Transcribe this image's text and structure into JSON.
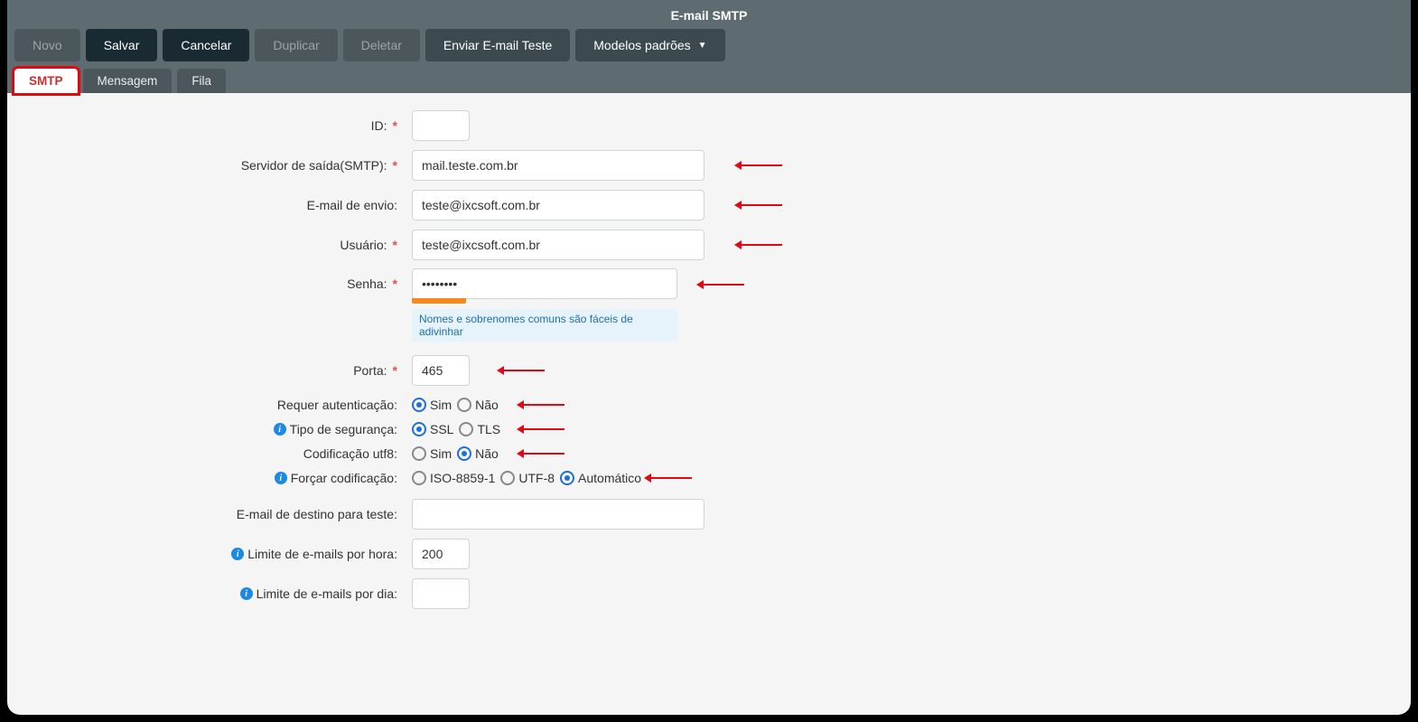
{
  "title": "E-mail SMTP",
  "toolbar": {
    "novo": "Novo",
    "salvar": "Salvar",
    "cancelar": "Cancelar",
    "duplicar": "Duplicar",
    "deletar": "Deletar",
    "enviar_teste": "Enviar E-mail Teste",
    "modelos": "Modelos padrões"
  },
  "tabs": {
    "smtp": "SMTP",
    "mensagem": "Mensagem",
    "fila": "Fila"
  },
  "labels": {
    "id": "ID:",
    "servidor": "Servidor de saída(SMTP):",
    "email_envio": "E-mail de envio:",
    "usuario": "Usuário:",
    "senha": "Senha:",
    "porta": "Porta:",
    "requer_aut": "Requer autenticação:",
    "tipo_seg": "Tipo de segurança:",
    "cod_utf8": "Codificação utf8:",
    "forcar_cod": "Forçar codificação:",
    "email_destino": "E-mail de destino para teste:",
    "lim_hora": "Limite de e-mails por hora:",
    "lim_dia": "Limite de e-mails por dia:"
  },
  "fields": {
    "id": "",
    "servidor": "mail.teste.com.br",
    "email_envio": "teste@ixcsoft.com.br",
    "usuario": "teste@ixcsoft.com.br",
    "senha": "••••••••",
    "senha_hint": "Nomes e sobrenomes comuns são fáceis de adivinhar",
    "porta": "465",
    "requer_aut": {
      "sim": "Sim",
      "nao": "Não",
      "selected": "sim"
    },
    "tipo_seg": {
      "ssl": "SSL",
      "tls": "TLS",
      "selected": "ssl"
    },
    "cod_utf8": {
      "sim": "Sim",
      "nao": "Não",
      "selected": "nao"
    },
    "forcar_cod": {
      "iso": "ISO-8859-1",
      "utf8": "UTF-8",
      "auto": "Automático",
      "selected": "auto"
    },
    "email_destino": "",
    "lim_hora": "200",
    "lim_dia": ""
  }
}
